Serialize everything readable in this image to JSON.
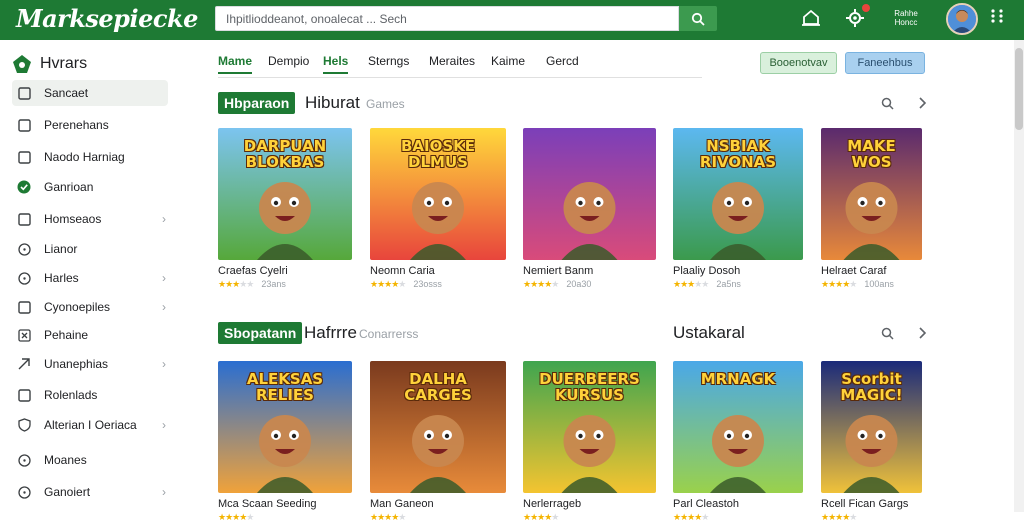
{
  "app": {
    "title": "Marksepiecke"
  },
  "search": {
    "text": "Ihpitlioddeanot, onoalecat ... Sech"
  },
  "topbar": {
    "small_text": "Rahhe Honcc",
    "accent": "#1e7a34"
  },
  "sidebar": {
    "header": "Hvrars",
    "items": [
      {
        "label": "Sancaet",
        "icon": "square-icon",
        "active": true,
        "chevron": false
      },
      {
        "label": "Perenehans",
        "icon": "square-icon",
        "active": false,
        "chevron": false
      },
      {
        "label": "Naodo Harniag",
        "icon": "square-icon",
        "active": false,
        "chevron": false
      },
      {
        "label": "Ganrioan",
        "icon": "check-circle-icon",
        "active": false,
        "chevron": false
      },
      {
        "label": "Homseaos",
        "icon": "square-icon",
        "active": false,
        "chevron": true
      },
      {
        "label": "Lianor",
        "icon": "circle-icon",
        "active": false,
        "chevron": false
      },
      {
        "label": "Harles",
        "icon": "circle-icon",
        "active": false,
        "chevron": true
      },
      {
        "label": "Cyonoepiles",
        "icon": "square-icon",
        "active": false,
        "chevron": true
      },
      {
        "label": "Pehaine",
        "icon": "close-box-icon",
        "active": false,
        "chevron": false
      },
      {
        "label": "Unanephias",
        "icon": "link-icon",
        "active": false,
        "chevron": true
      },
      {
        "label": "Rolenlads",
        "icon": "square-icon",
        "active": false,
        "chevron": false
      },
      {
        "label": "Alterian I Oeriaca",
        "icon": "shield-icon",
        "active": false,
        "chevron": true
      },
      {
        "label": "Moanes",
        "icon": "circle-icon",
        "active": false,
        "chevron": false
      },
      {
        "label": "Ganoiert",
        "icon": "circle-icon",
        "active": false,
        "chevron": true
      }
    ]
  },
  "tabs": [
    {
      "label": "Mame",
      "active": true
    },
    {
      "label": "Dempio",
      "active": false
    },
    {
      "label": "Hels",
      "active": true
    },
    {
      "label": "Sterngs",
      "active": false
    },
    {
      "label": "Meraites",
      "active": false
    },
    {
      "label": "Kaime",
      "active": false
    },
    {
      "label": "Gercd",
      "active": false
    }
  ],
  "actions": {
    "green": "Booenotvav",
    "blue": "Faneehbus"
  },
  "sections": [
    {
      "badge": "Hbparaon",
      "title": "Hiburat",
      "subtitle": "Games",
      "right": "",
      "cards": [
        {
          "title": "Craefas Cyelri",
          "rating": 3,
          "count": "23ans",
          "art": "DARPUAN BLOKBAS",
          "colors": [
            "#7cc4f0",
            "#56a83a"
          ]
        },
        {
          "title": "Neomn Caria",
          "rating": 4,
          "count": "23osss",
          "art": "BAIOSKE DLMUS",
          "colors": [
            "#ffd83b",
            "#e8453c"
          ]
        },
        {
          "title": "Nemiert Banm",
          "rating": 4,
          "count": "20a30",
          "art": "",
          "colors": [
            "#7b3fb9",
            "#d94b7a"
          ]
        },
        {
          "title": "Plaaliy Dosoh",
          "rating": 3,
          "count": "2a5ns",
          "art": "NSBIAK RIVONAS",
          "colors": [
            "#5cb8f0",
            "#3b9a4c"
          ]
        },
        {
          "title": "Helraet Caraf",
          "rating": 4,
          "count": "100ans",
          "art": "MAKE WOS",
          "colors": [
            "#5a2a6e",
            "#e8893a"
          ]
        }
      ]
    },
    {
      "badge": "Sbopatann",
      "title": "Hafrrre",
      "subtitle": "Conarrerss",
      "right": "Ustakaral",
      "cards": [
        {
          "title": "Mca Scaan Seeding",
          "rating": 4,
          "count": "",
          "art": "ALEKSAS RELIES",
          "colors": [
            "#2a6ed1",
            "#f0a23a"
          ]
        },
        {
          "title": "Man Ganeon",
          "rating": 4,
          "count": "",
          "art": "DALHA CARGES",
          "colors": [
            "#7a3a1e",
            "#e88b3a"
          ]
        },
        {
          "title": "Nerlerrageb",
          "rating": 4,
          "count": "",
          "art": "DUERBEERS KURSUS",
          "colors": [
            "#3fa54f",
            "#f4c430"
          ]
        },
        {
          "title": "Parl Cleastoh",
          "rating": 4,
          "count": "",
          "art": "MRNAGK",
          "colors": [
            "#4aa8e8",
            "#9ad14b"
          ]
        },
        {
          "title": "Rcell Fican Gargs",
          "rating": 4,
          "count": "",
          "art": "Scorbit MAGIC!",
          "colors": [
            "#1a2a7a",
            "#f0c23a"
          ]
        }
      ]
    }
  ]
}
